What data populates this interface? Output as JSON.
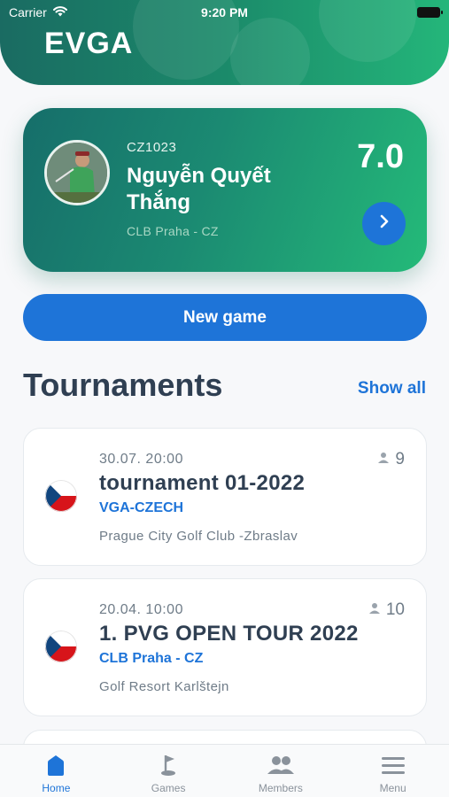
{
  "status_bar": {
    "carrier": "Carrier",
    "time": "9:20 PM"
  },
  "app": {
    "title": "EVGA"
  },
  "profile": {
    "code": "CZ1023",
    "name": "Nguyễn Quyết Thắng",
    "club": "CLB Praha - CZ",
    "handicap": "7.0"
  },
  "actions": {
    "new_game": "New game"
  },
  "tournaments": {
    "title": "Tournaments",
    "show_all": "Show all",
    "items": [
      {
        "date": "30.07. 20:00",
        "name": "tournament 01-2022",
        "organizer": "VGA-CZECH",
        "venue": "Prague City Golf Club -Zbraslav",
        "players": "9",
        "flag": "czech-flag"
      },
      {
        "date": "20.04. 10:00",
        "name": "1. PVG OPEN TOUR 2022",
        "organizer": "CLB Praha - CZ",
        "venue": "Golf Resort Karlštejn",
        "players": "10",
        "flag": "czech-flag"
      }
    ]
  },
  "tabbar": {
    "items": [
      {
        "label": "Home",
        "icon": "home-icon",
        "active": true
      },
      {
        "label": "Games",
        "icon": "golf-flag-icon",
        "active": false
      },
      {
        "label": "Members",
        "icon": "members-icon",
        "active": false
      },
      {
        "label": "Menu",
        "icon": "menu-icon",
        "active": false
      }
    ]
  },
  "colors": {
    "brand_green": "#1b8a72",
    "accent_blue": "#1e74d8",
    "text_dark": "#2f3f52",
    "text_muted": "#6f7c88"
  }
}
